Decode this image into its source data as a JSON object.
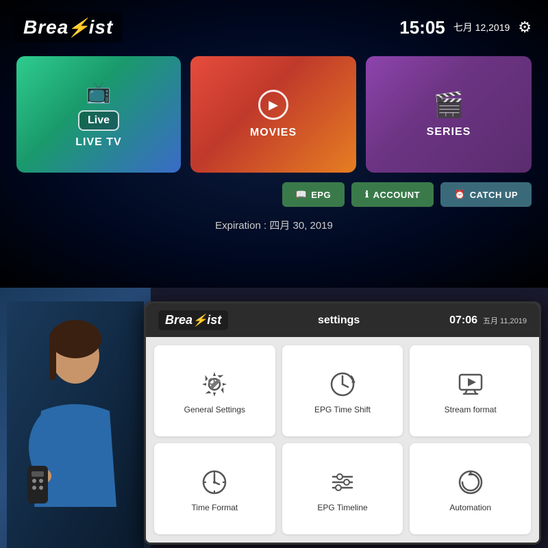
{
  "top": {
    "logo": {
      "prefix": "Brea",
      "bolt": "⚡",
      "suffix": "ist"
    },
    "clock": "15:05",
    "date": "七月 12,2019",
    "cards": [
      {
        "id": "live-tv",
        "label": "LIVE TV",
        "badge": "Live",
        "gradient": "live"
      },
      {
        "id": "movies",
        "label": "MOVIES",
        "gradient": "movies"
      },
      {
        "id": "series",
        "label": "SERIES",
        "gradient": "series"
      }
    ],
    "buttons": [
      {
        "id": "epg",
        "label": "EPG",
        "icon": "📖"
      },
      {
        "id": "account",
        "label": "ACCOUNT",
        "icon": "ℹ️"
      },
      {
        "id": "catch-up",
        "label": "CATCH UP",
        "icon": "⏰"
      }
    ],
    "expiration": "Expiration : 四月 30, 2019"
  },
  "bottom": {
    "settings_header": {
      "logo_prefix": "Brea",
      "logo_bolt": "⚡",
      "logo_suffix": "ist",
      "title": "settings",
      "clock": "07:06",
      "date": "五月 11,2019"
    },
    "settings_cards": [
      {
        "id": "general-settings",
        "label": "General Settings"
      },
      {
        "id": "epg-time-shift",
        "label": "EPG Time Shift"
      },
      {
        "id": "stream-format",
        "label": "Stream format"
      },
      {
        "id": "time-format",
        "label": "Time Format"
      },
      {
        "id": "epg-timeline",
        "label": "EPG Timeline"
      },
      {
        "id": "automation",
        "label": "Automation"
      }
    ]
  }
}
